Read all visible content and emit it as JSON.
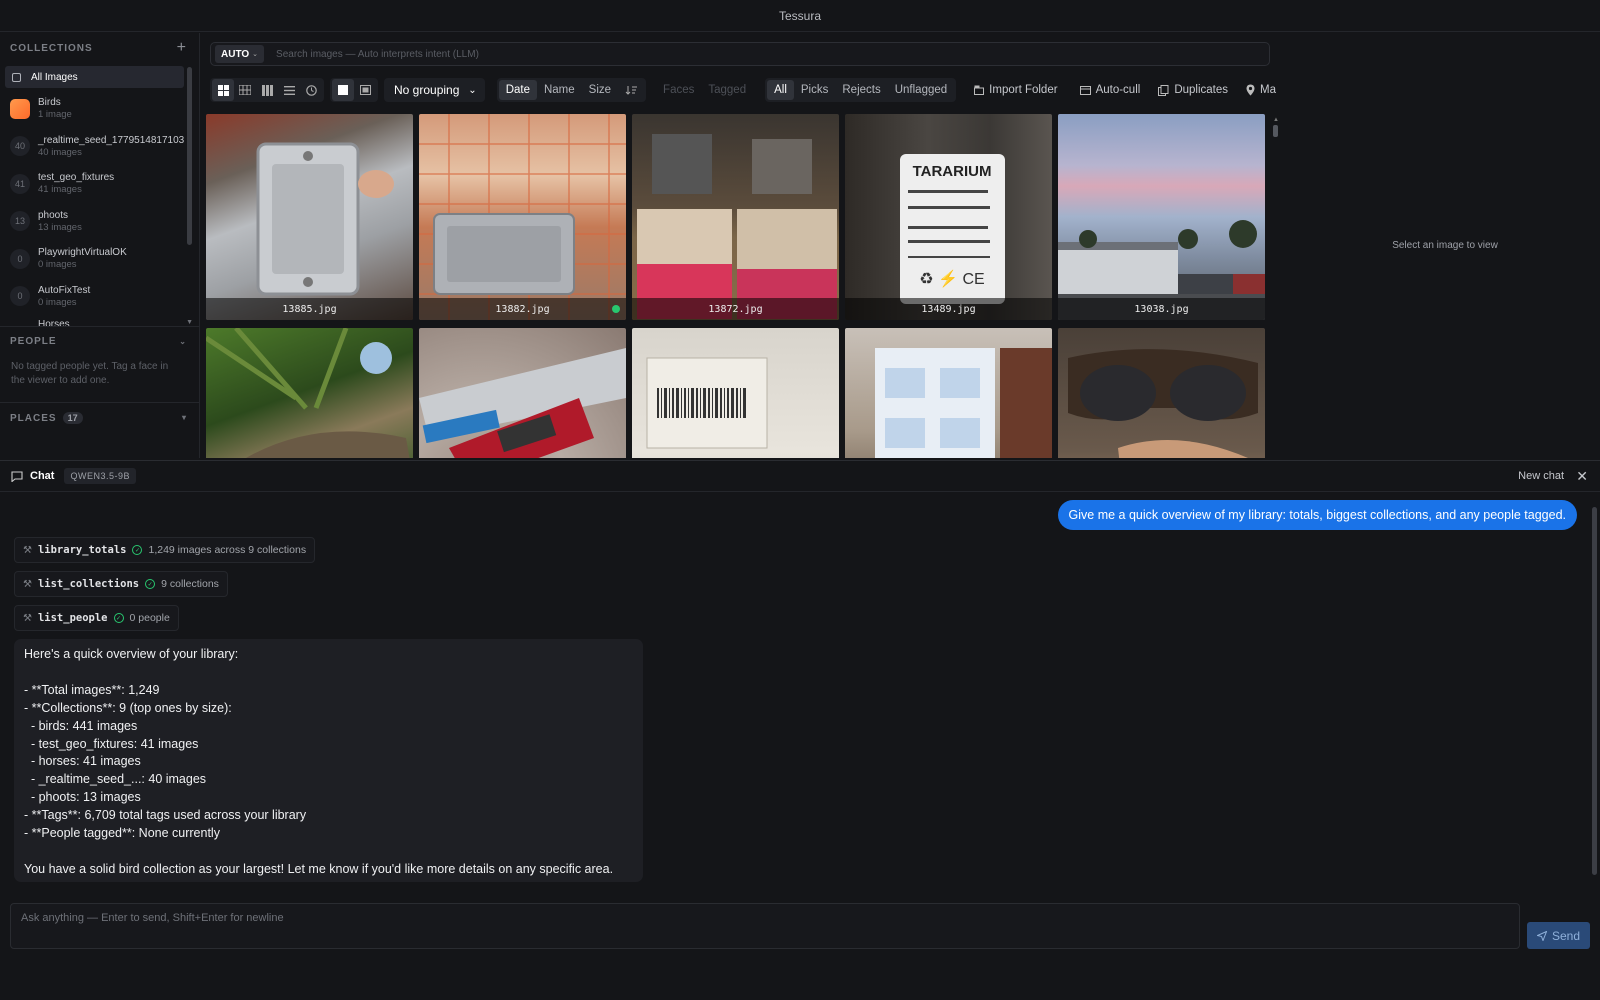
{
  "app": {
    "title": "Tessura"
  },
  "sidebar": {
    "collections_header": "COLLECTIONS",
    "all_images_label": "All Images",
    "collections": [
      {
        "name": "Birds",
        "count": "1 image",
        "badge": ""
      },
      {
        "name": "_realtime_seed_1779514817103",
        "count": "40 images",
        "badge": "40"
      },
      {
        "name": "test_geo_fixtures",
        "count": "41 images",
        "badge": "41"
      },
      {
        "name": "phoots",
        "count": "13 images",
        "badge": "13"
      },
      {
        "name": "PlaywrightVirtualOK",
        "count": "0 images",
        "badge": "0"
      },
      {
        "name": "AutoFixTest",
        "count": "0 images",
        "badge": "0"
      },
      {
        "name": "Horses",
        "count": "",
        "badge": ""
      }
    ],
    "people_header": "PEOPLE",
    "people_empty": "No tagged people yet. Tag a face in the viewer to add one.",
    "places_header": "PLACES",
    "places_count": "17"
  },
  "search": {
    "mode": "AUTO",
    "placeholder": "Search images — Auto interprets intent (LLM)"
  },
  "toolbar": {
    "grouping": "No grouping",
    "sort_options": [
      "Date",
      "Name",
      "Size"
    ],
    "sort_active": "Date",
    "facets": [
      "Faces",
      "Tagged"
    ],
    "filters": [
      "All",
      "Picks",
      "Rejects",
      "Unflagged"
    ],
    "filter_active": "All",
    "import_label": "Import Folder",
    "autocull_label": "Auto-cull",
    "duplicates_label": "Duplicates",
    "map_label": "Ma"
  },
  "grid": {
    "row1": [
      "13885.jpg",
      "13882.jpg",
      "13872.jpg",
      "13489.jpg",
      "13038.jpg"
    ]
  },
  "viewer": {
    "empty_text": "Select an image to view"
  },
  "chat": {
    "title": "Chat",
    "model": "QWEN3.5-9B",
    "new_chat_label": "New chat",
    "user_message": "Give me a quick overview of my library: totals, biggest collections, and any people tagged.",
    "tool_calls": [
      {
        "name": "library_totals",
        "result": "1,249 images across 9 collections"
      },
      {
        "name": "list_collections",
        "result": "9 collections"
      },
      {
        "name": "list_people",
        "result": "0 people"
      }
    ],
    "assistant_message": "Here's a quick overview of your library:\n\n- **Total images**: 1,249\n- **Collections**: 9 (top ones by size):\n  - birds: 441 images\n  - test_geo_fixtures: 41 images\n  - horses: 41 images\n  - _realtime_seed_...: 40 images\n  - phoots: 13 images\n- **Tags**: 6,709 total tags used across your library\n- **People tagged**: None currently\n\nYou have a solid bird collection as your largest! Let me know if you'd like more details on any specific area.",
    "composer_placeholder": "Ask anything — Enter to send, Shift+Enter for newline",
    "send_label": "Send"
  },
  "colors": {
    "accent": "#1a73e8",
    "success": "#28c76f",
    "background": "#141518"
  }
}
